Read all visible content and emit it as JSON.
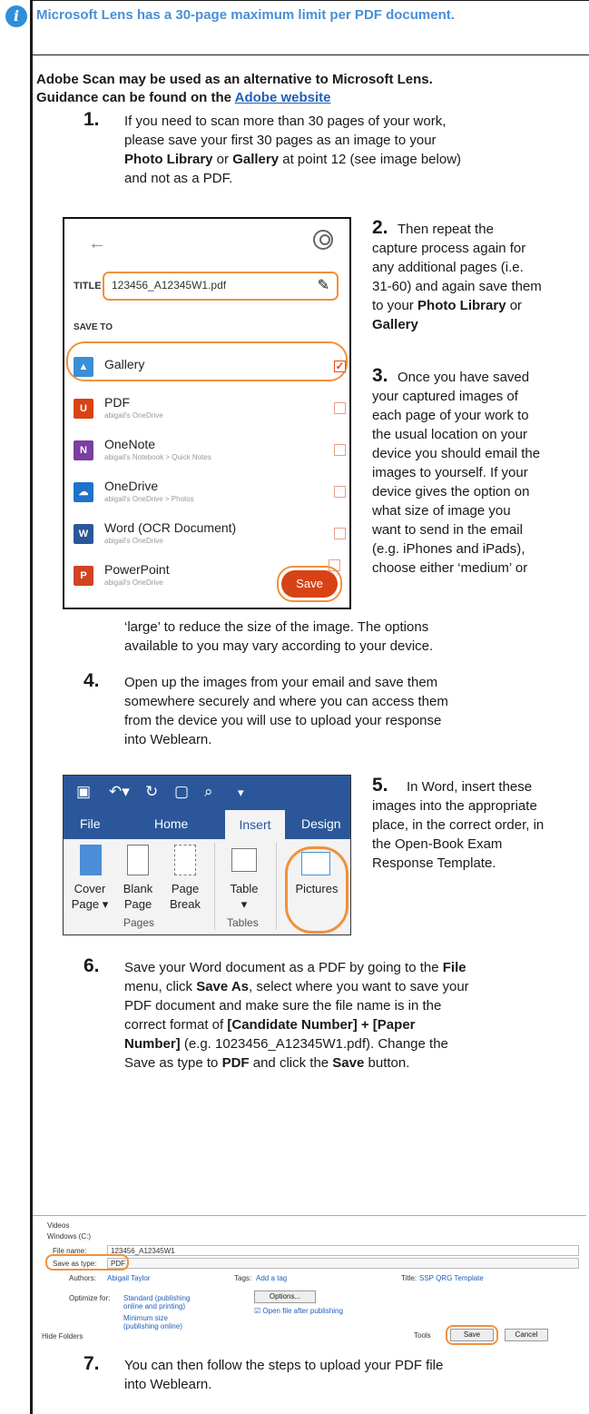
{
  "notice": "Microsoft Lens has a 30-page maximum limit per PDF document.",
  "alternative": {
    "line1": "Adobe Scan may be used as an alternative to Microsoft Lens.",
    "line2_prefix": "Guidance can be found on the ",
    "link": "Adobe website"
  },
  "steps": {
    "s1": {
      "num": "1.",
      "a": "If you need to scan more than 30 pages of your work,",
      "b": "please save your first 30 pages as an image to your",
      "c1": "Photo Library",
      "c2": " or ",
      "c3": "Gallery",
      "c4": " at point 12 (see image below)",
      "d": "and not as a PDF."
    },
    "s2": {
      "num": "2.",
      "a": "Then repeat the",
      "b": "capture process again for",
      "c": "any additional pages (i.e.",
      "d": "31-60) and again save them",
      "e1": "to your ",
      "e2": "Photo Library",
      "e3": " or",
      "f": "Gallery"
    },
    "s3": {
      "num": "3.",
      "a": "Once you have saved",
      "b": "your captured images of",
      "c": "each page of your work to",
      "d": "the usual location on your",
      "e": "device you should email the",
      "f": "images to yourself. If your",
      "g": "device gives the option on",
      "h": "what size of image you",
      "i": "want to send in the email",
      "j": "(e.g. iPhones and iPads),",
      "k": "choose either ‘medium’ or",
      "l": "‘large’ to reduce the size of the image. The options",
      "m": "available to you may vary according to your device."
    },
    "s4": {
      "num": "4.",
      "a": "Open up the images from your email and save them",
      "b": "somewhere securely and where you can access them",
      "c": "from the device you will use to upload your response",
      "d": "into Weblearn."
    },
    "s5": {
      "num": "5.",
      "a": "In Word, insert these",
      "b": "images into the appropriate",
      "c": "place, in the correct order, in",
      "d": "the Open-Book Exam",
      "e": "Response Template."
    },
    "s6": {
      "num": "6.",
      "a1": "Save your Word document as a PDF by going to the ",
      "a2": "File",
      "b1": "menu, click ",
      "b2": "Save As",
      "b3": ", select where you want to save your",
      "c": "PDF document and make sure the file name is in the",
      "d1": "correct format of ",
      "d2": "[Candidate Number] + [Paper",
      "e1": "Number]",
      "e2": " (e.g. 1023456_A12345W1.pdf). Change the",
      "f1": "Save as type to ",
      "f2": "PDF",
      "f3": " and click the ",
      "f4": "Save",
      "f5": " button."
    },
    "s7": {
      "num": "7.",
      "a": "You can then follow the steps to upload your PDF file",
      "b": "into Weblearn."
    }
  },
  "phone": {
    "back": "←",
    "title_label": "TITLE",
    "title_value": "123456_A12345W1.pdf",
    "save_to": "SAVE TO",
    "items": [
      {
        "name": "Gallery",
        "sub": "",
        "color": "#3b8ed8",
        "icon": "gallery-icon"
      },
      {
        "name": "PDF",
        "sub": "abigail's OneDrive",
        "color": "#d84315",
        "icon": "pdf-icon"
      },
      {
        "name": "OneNote",
        "sub": "abigail's Notebook > Quick Notes",
        "color": "#7b3fa0",
        "icon": "onenote-icon"
      },
      {
        "name": "OneDrive",
        "sub": "abigail's OneDrive > Photos",
        "color": "#1e73c8",
        "icon": "onedrive-icon"
      },
      {
        "name": "Word (OCR Document)",
        "sub": "abigail's OneDrive",
        "color": "#2b579a",
        "icon": "word-icon"
      },
      {
        "name": "PowerPoint",
        "sub": "abigail's OneDrive",
        "color": "#d04423",
        "icon": "powerpoint-icon"
      }
    ],
    "save": "Save"
  },
  "ribbon": {
    "tabs": {
      "file": "File",
      "home": "Home",
      "insert": "Insert",
      "design": "Design"
    },
    "cmds": {
      "cover1": "Cover",
      "cover2": "Page ▾",
      "blank1": "Blank",
      "blank2": "Page",
      "break1": "Page",
      "break2": "Break",
      "table": "Table",
      "table2": "▾",
      "pictures": "Pictures"
    },
    "groups": {
      "pages": "Pages",
      "tables": "Tables"
    }
  },
  "dialog": {
    "videos": "Videos",
    "drive": "Windows (C:)",
    "filename_label": "File name:",
    "filename": "123456_A12345W1",
    "savetype_label": "Save as type:",
    "savetype": "PDF",
    "authors_label": "Authors:",
    "authors": "Abigail Taylor",
    "tags_label": "Tags:",
    "tags": "Add a tag",
    "title_label": "Title:",
    "title": "SSP QRG Template",
    "optimize_label": "Optimize for:",
    "opt1a": "Standard (publishing",
    "opt1b": "online and printing)",
    "opt2a": "Minimum size",
    "opt2b": "(publishing online)",
    "options": "Options...",
    "open_after": "Open file after publishing",
    "hide": "Hide Folders",
    "tools": "Tools",
    "save": "Save",
    "cancel": "Cancel"
  }
}
